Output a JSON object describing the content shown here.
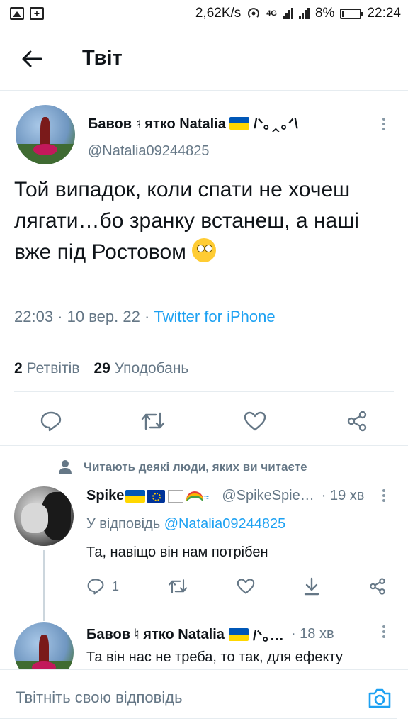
{
  "status_bar": {
    "speed": "2,62K/s",
    "network": "4G",
    "battery_pct_label": "8%",
    "battery_level": 0.08,
    "time": "22:24"
  },
  "header": {
    "title": "Твіт",
    "back_icon": "arrow-left-icon"
  },
  "tweet": {
    "author_name": "Бавов ♮ ятко Natalia",
    "author_name_suffix": "/ᐠ｡‸｡ᐟ\\",
    "handle": "@Natalia09244825",
    "text": "Той випадок, коли спати не хочеш лягати…бо зранку встанеш, а наші вже під Ростовом",
    "emoji": "face-with-rolling-eyes",
    "time": "22:03",
    "date": "10 вер. 22",
    "source": "Twitter for iPhone",
    "retweets_count": "2",
    "retweets_label": "Ретвітів",
    "likes_count": "29",
    "likes_label": "Уподобань"
  },
  "social_context": "Читають деякі люди, яких ви читаєте",
  "replies": [
    {
      "name": "Spike",
      "handle": "@SpikeSpie…",
      "time": "· 19 хв",
      "in_reply_prefix": "У відповідь",
      "in_reply_to": "@Natalia09244825",
      "text": "Та, навіщо він нам потрібен",
      "reply_count": "1"
    },
    {
      "name": "Бавов ♮ ятко Natalia",
      "name_suffix": "/ᐠ｡…",
      "time": "· 18 хв",
      "text": "Та він нас не треба, то так, для ефекту"
    }
  ],
  "compose": {
    "placeholder": "Твітніть свою відповідь",
    "camera_icon": "camera-icon"
  },
  "colors": {
    "accent": "#1da1f2",
    "muted": "#657786",
    "text": "#0f1419",
    "divider": "#e6ecf0"
  }
}
